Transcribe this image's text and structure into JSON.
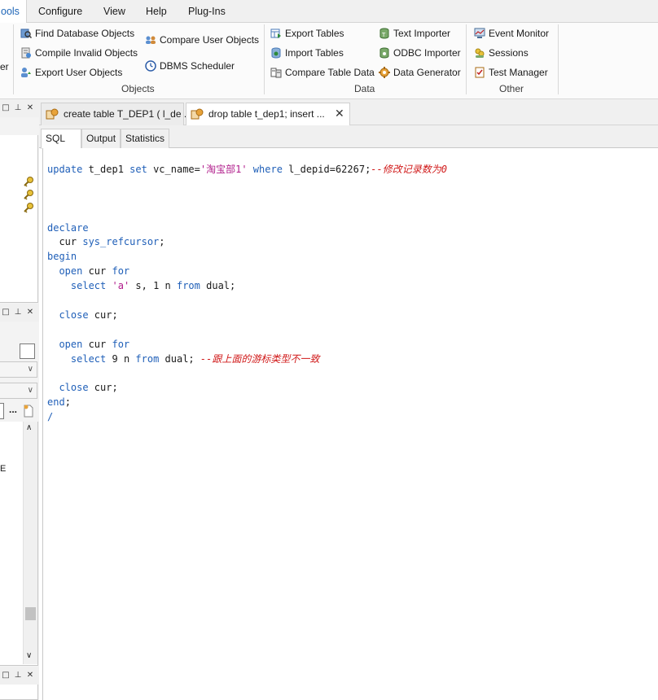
{
  "menu": {
    "tabs": [
      {
        "label": "ools",
        "active": true
      },
      {
        "label": "Configure"
      },
      {
        "label": "View"
      },
      {
        "label": "Help"
      },
      {
        "label": "Plug-Ins"
      }
    ]
  },
  "ribbon": {
    "left_fragment": "er",
    "objects": {
      "label": "Objects",
      "items": [
        {
          "label": "Find Database Objects",
          "icon": "find-objects-icon"
        },
        {
          "label": "Compile Invalid Objects",
          "icon": "compile-icon"
        },
        {
          "label": "Export User Objects",
          "icon": "export-user-icon"
        },
        {
          "label": "Compare User Objects",
          "icon": "compare-users-icon"
        },
        {
          "label": "DBMS Scheduler",
          "icon": "clock-icon"
        }
      ]
    },
    "data": {
      "label": "Data",
      "items": [
        {
          "label": "Export Tables",
          "icon": "export-tables-icon"
        },
        {
          "label": "Import Tables",
          "icon": "import-tables-icon"
        },
        {
          "label": "Compare Table Data",
          "icon": "compare-data-icon"
        },
        {
          "label": "Text Importer",
          "icon": "text-importer-icon"
        },
        {
          "label": "ODBC Importer",
          "icon": "odbc-importer-icon"
        },
        {
          "label": "Data Generator",
          "icon": "data-generator-icon"
        }
      ]
    },
    "other": {
      "label": "Other",
      "items": [
        {
          "label": "Event Monitor",
          "icon": "event-monitor-icon"
        },
        {
          "label": "Sessions",
          "icon": "sessions-icon"
        },
        {
          "label": "Test Manager",
          "icon": "test-manager-icon"
        }
      ]
    }
  },
  "left_panel": {
    "dots": "...",
    "fragment": "E"
  },
  "doc_tabs": [
    {
      "label": "create table T_DEP1 ( l_de ..."
    },
    {
      "label": "drop table t_dep1; insert ...",
      "active": true,
      "close": "✕"
    }
  ],
  "sub_tabs": [
    "SQL",
    "Output",
    "Statistics"
  ],
  "sql": {
    "lines": [
      [
        {
          "t": "update",
          "c": "kw"
        },
        {
          "t": " t_dep1 ",
          "c": "op"
        },
        {
          "t": "set",
          "c": "kw"
        },
        {
          "t": " vc_name=",
          "c": "op"
        },
        {
          "t": "'淘宝部1'",
          "c": "str"
        },
        {
          "t": " ",
          "c": "op"
        },
        {
          "t": "where",
          "c": "kw"
        },
        {
          "t": " l_depid=62267;",
          "c": "op"
        },
        {
          "t": "--修改记录数为0",
          "c": "cmt"
        }
      ],
      [],
      [],
      [],
      [
        {
          "t": "declare",
          "c": "kw"
        }
      ],
      [
        {
          "t": "  cur ",
          "c": "op"
        },
        {
          "t": "sys_refcursor",
          "c": "kw"
        },
        {
          "t": ";",
          "c": "op"
        }
      ],
      [
        {
          "t": "begin",
          "c": "kw"
        }
      ],
      [
        {
          "t": "  ",
          "c": "op"
        },
        {
          "t": "open",
          "c": "kw"
        },
        {
          "t": " cur ",
          "c": "op"
        },
        {
          "t": "for",
          "c": "kw"
        }
      ],
      [
        {
          "t": "    ",
          "c": "op"
        },
        {
          "t": "select",
          "c": "kw"
        },
        {
          "t": " ",
          "c": "op"
        },
        {
          "t": "'a'",
          "c": "str"
        },
        {
          "t": " s, 1 n ",
          "c": "op"
        },
        {
          "t": "from",
          "c": "kw"
        },
        {
          "t": " dual;",
          "c": "op"
        }
      ],
      [],
      [
        {
          "t": "  ",
          "c": "op"
        },
        {
          "t": "close",
          "c": "kw"
        },
        {
          "t": " cur;",
          "c": "op"
        }
      ],
      [],
      [
        {
          "t": "  ",
          "c": "op"
        },
        {
          "t": "open",
          "c": "kw"
        },
        {
          "t": " cur ",
          "c": "op"
        },
        {
          "t": "for",
          "c": "kw"
        }
      ],
      [
        {
          "t": "    ",
          "c": "op"
        },
        {
          "t": "select",
          "c": "kw"
        },
        {
          "t": " 9 n ",
          "c": "op"
        },
        {
          "t": "from",
          "c": "kw"
        },
        {
          "t": " dual; ",
          "c": "op"
        },
        {
          "t": "--跟上面的游标类型不一致",
          "c": "cmt"
        }
      ],
      [],
      [
        {
          "t": "  ",
          "c": "op"
        },
        {
          "t": "close",
          "c": "kw"
        },
        {
          "t": " cur;",
          "c": "op"
        }
      ],
      [
        {
          "t": "end",
          "c": "kw"
        },
        {
          "t": ";",
          "c": "op"
        }
      ],
      [
        {
          "t": "/",
          "c": "kw"
        }
      ]
    ]
  }
}
